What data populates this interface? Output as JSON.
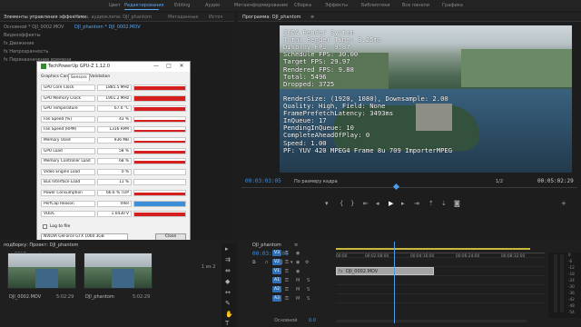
{
  "menu": {
    "items": [
      "Цвет",
      "Редактирование",
      "Editing",
      "Аудио",
      "Метаинформирование",
      "Сборка",
      "Эффекты",
      "Библиотеки",
      "Все панели",
      "Графика"
    ],
    "active_index": 1
  },
  "effects_panel": {
    "tabs": [
      "Элементы управления эффектами",
      "Микш. аудиоклипа: DJI_phantom",
      "Метаданные",
      "Источ"
    ],
    "source_label": "Основной * DJI_0002.MOV",
    "sequence_label": "DJI_phantom * DJI_0002.MOV",
    "section": "Видеоэффекты",
    "rows": [
      "fx  Движение",
      "fx  Непрозрачность",
      "fx  Переназначение времени"
    ]
  },
  "gpuz": {
    "title": "TechPowerUp GPU-Z 1.12.0",
    "tabs": [
      "Graphics Card",
      "Sensors",
      "Validation"
    ],
    "selected_tab": 1,
    "sensors": [
      {
        "label": "GPU Core Clock",
        "value": "1885.5 MHz",
        "level": 0.9
      },
      {
        "label": "GPU Memory Clock",
        "value": "1901.2 MHz",
        "level": 0.9
      },
      {
        "label": "GPU Temperature",
        "value": "67.0 °C",
        "level": 0.8
      },
      {
        "label": "Fan Speed (%)",
        "value": "43 %",
        "level": 0.45
      },
      {
        "label": "Fan Speed (RPM)",
        "value": "1316 RPM",
        "level": 0.45
      },
      {
        "label": "Memory Used",
        "value": "936 MB",
        "level": 0.35
      },
      {
        "label": "GPU Load",
        "value": "58 %",
        "level": 0.6
      },
      {
        "label": "Memory Controller Load",
        "value": "68 %",
        "level": 0.65
      },
      {
        "label": "Video Engine Load",
        "value": "0 %",
        "level": 0.0
      },
      {
        "label": "Bus Interface Load",
        "value": "11 %",
        "level": 0.12
      },
      {
        "label": "Power Consumption",
        "value": "66.6 % TDP",
        "level": 0.6
      },
      {
        "label": "PerfCap Reason",
        "value": "VRel",
        "level": 1.0,
        "blue": true
      },
      {
        "label": "VDDC",
        "value": "1.0430 V",
        "level": 0.75
      }
    ],
    "log_label": "Log to file",
    "gpu_select": "NVIDIA GeForce GTX 1060 3GB",
    "close_label": "Close",
    "minimize": "—",
    "maximize": "□",
    "close_x": "✕"
  },
  "program": {
    "tab": "Программа: DJI_phantom",
    "menu_glyph": "≡",
    "timecode_current": "00:03:03:05",
    "fit": "По размеру кадра",
    "page": "1/2",
    "timecode_total": "00:05:02:29",
    "overlay_lines": [
      "CUDA Render System",
      "Total Render Time: 3.25ms",
      "Display FPS: 9.87",
      "Schedule FPS: 30.00",
      "Target FPS: 29.97",
      "Rendered FPS: 9.88",
      "Total: 5496",
      "Dropped: 3725",
      "",
      "RenderSize: (1920, 1080), Downsample: 2.00",
      "Quality: High, Field: None",
      "FramePrefetchLatency: 3493ms",
      "InQueue: 17",
      "PendingInQueue: 10",
      "CompleteAheadOfPlay: 0",
      "Speed: 1.00",
      "PF: YUV 420 MPEG4 Frame 8u 709 ImporterMPEG"
    ]
  },
  "project": {
    "tab": "подборку: Проект: DJI_phantom",
    "path": "2017.prproj",
    "items_count": "1 из 2",
    "clips": [
      {
        "name": "DJI_0002.MOV",
        "duration": "5:02:29"
      },
      {
        "name": "DJI_phantom",
        "duration": "5:02:29"
      }
    ]
  },
  "timeline": {
    "tab": "DJI_phantom",
    "menu_glyph": "≡",
    "timecode": "00:03:03:05",
    "ruler": [
      "00:00",
      "00:02:08:00",
      "00:04:16:00",
      "00:06:24:00",
      "00:08:32:00"
    ],
    "tracks_video": [
      "V3",
      "V2",
      "V1"
    ],
    "tracks_audio": [
      "A1",
      "A2",
      "A3"
    ],
    "clip_name": "DJI_0002.MOV",
    "clip_fx": "fx",
    "master_label": "Основной",
    "master_value": "0.0",
    "vu_scale": [
      "0",
      "-6",
      "-12",
      "-18",
      "-24",
      "-30",
      "-36",
      "-42",
      "-48",
      "-54"
    ]
  }
}
